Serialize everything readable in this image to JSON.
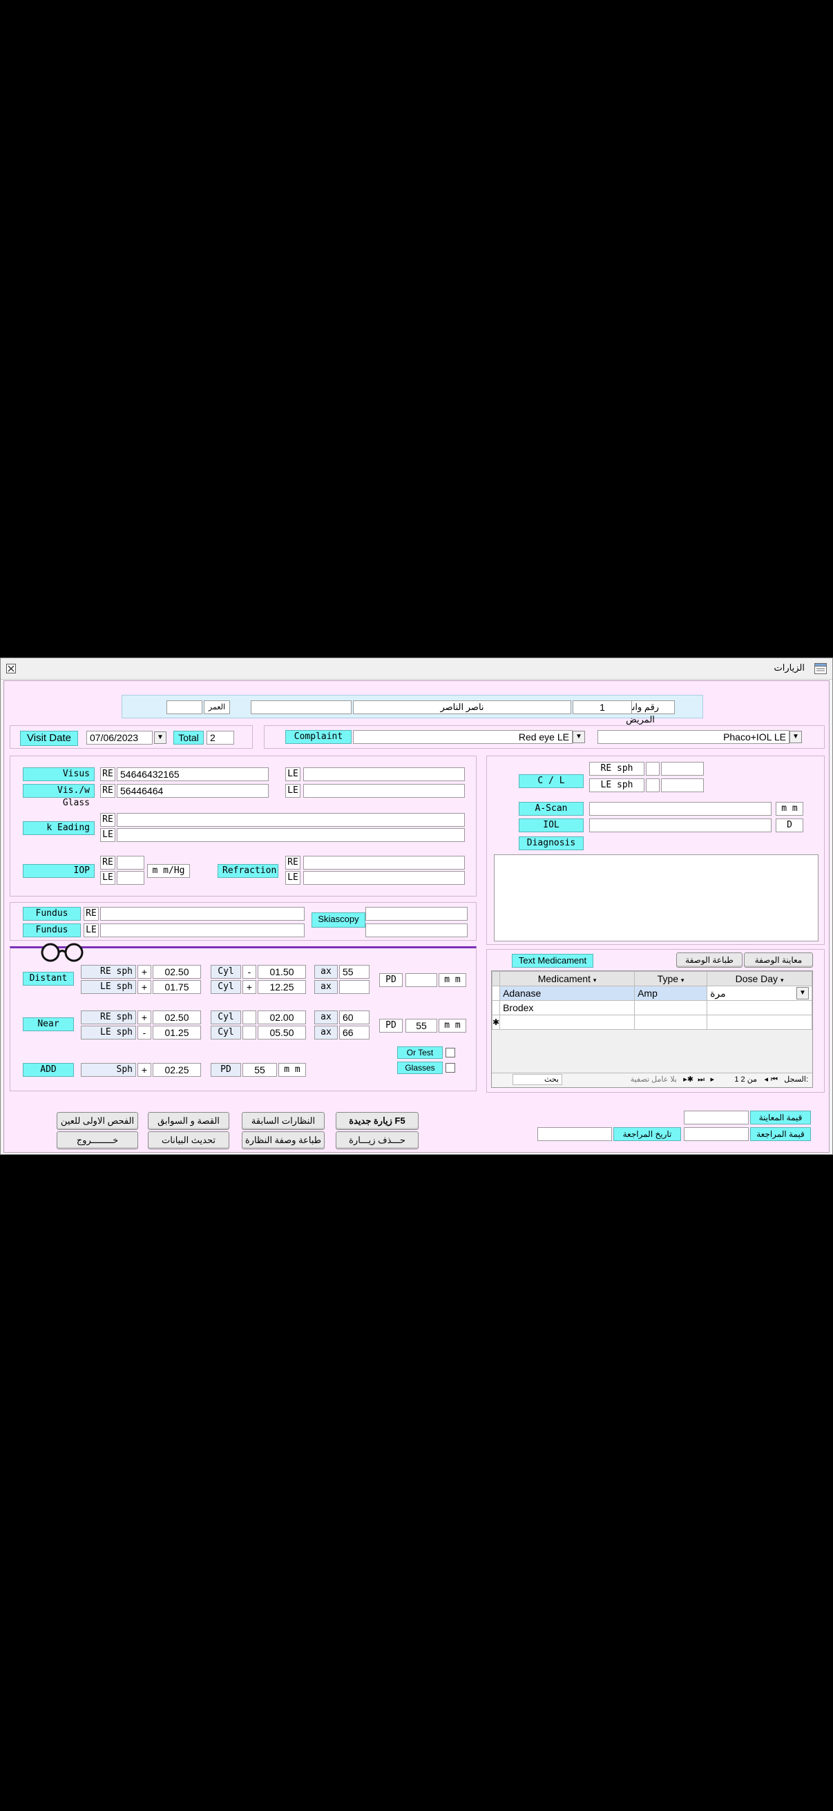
{
  "window": {
    "title": "الزيارات"
  },
  "patient": {
    "label": "رقم واسم المريض",
    "number": "1",
    "name": "ناصر الناصر",
    "extra": "",
    "age_label": "العمر",
    "age": ""
  },
  "visit": {
    "date_label": "Visit Date",
    "date": "07/06/2023",
    "total_label": "Total",
    "total": "2",
    "complaint_label": "Complaint",
    "complaint": "Red eye LE",
    "complaint2": "Phaco+IOL LE"
  },
  "exam": {
    "visus_label": "Visus",
    "visus_re": "54646432165",
    "visus_le": "",
    "glass_label": "Vis./w Glass",
    "glass_re": "56446464",
    "glass_le": "",
    "kreading_label": "k Eading",
    "k_re": "",
    "k_le": "",
    "iop_label": "IOP",
    "iop_re": "",
    "iop_le": "",
    "iop_unit": "m m/Hg",
    "refraction_label": "Refraction",
    "refr_re": "",
    "refr_le": "",
    "re": "RE",
    "le": "LE",
    "fundus_label": "Fundus",
    "fundus_re": "",
    "fundus_le": "",
    "skiascopy_label": "Skiascopy"
  },
  "right": {
    "cl_label": "C / L",
    "re_sph": "RE sph",
    "le_sph": "LE sph",
    "ascan_label": "A-Scan",
    "mm": "m m",
    "iol_label": "IOL",
    "d": "D",
    "diagnosis_label": "Diagnosis"
  },
  "glasses": {
    "distant_label": "Distant",
    "near_label": "Near",
    "add_label": "ADD",
    "re_sph": "RE sph",
    "le_sph": "LE sph",
    "sph": "Sph",
    "cyl": "Cyl",
    "ax": "ax",
    "pd": "PD",
    "mm": "m m",
    "dist_re_sign": "+",
    "dist_re_sph": "02.50",
    "dist_re_cyl_sign": "-",
    "dist_re_cyl": "01.50",
    "dist_re_ax": "55",
    "dist_le_sign": "+",
    "dist_le_sph": "01.75",
    "dist_le_cyl_sign": "+",
    "dist_le_cyl": "12.25",
    "dist_le_ax": "",
    "dist_pd": "",
    "near_re_sign": "+",
    "near_re_sph": "02.50",
    "near_re_cyl_sign": "",
    "near_re_cyl": "02.00",
    "near_re_ax": "60",
    "near_le_sign": "-",
    "near_le_sph": "01.25",
    "near_le_cyl_sign": "",
    "near_le_cyl": "05.50",
    "near_le_ax": "66",
    "near_pd": "55",
    "add_sign": "+",
    "add_sph": "02.25",
    "add_pd": "55",
    "or_test": "Or Test",
    "glasses_chk": "Glasses"
  },
  "meds": {
    "text_med_label": "Text Medicament",
    "print_rx": "طباعة الوصفة",
    "preview_rx": "معاينة الوصفة",
    "headers": [
      "Medicament",
      "Type",
      "Dose Day"
    ],
    "rows": [
      [
        "Adanase",
        "Amp",
        "مرة"
      ],
      [
        "Brodex",
        "",
        ""
      ]
    ],
    "nav_record": "السجل:",
    "nav_pos": "1 من 2",
    "nav_filter": "بلا عامل تصفية",
    "nav_search": "بحث"
  },
  "bottom": {
    "exam_value_label": "قيمة المعاينة",
    "review_value_label": "قيمة المراجعة",
    "review_date_label": "تاريخ المراجعة",
    "btn_new_visit": "زيارة جديدة F5",
    "btn_prev_glasses": "النظارات السابقة",
    "btn_history": "القصة و السوابق",
    "btn_first_exam": "الفحص الاولى للعين",
    "btn_delete_visit": "حـــذف زيـــارة",
    "btn_print_glasses": "طباعة وصفة النظارة",
    "btn_refresh": "تحديث البيانات",
    "btn_exit": "خــــــــروج"
  }
}
